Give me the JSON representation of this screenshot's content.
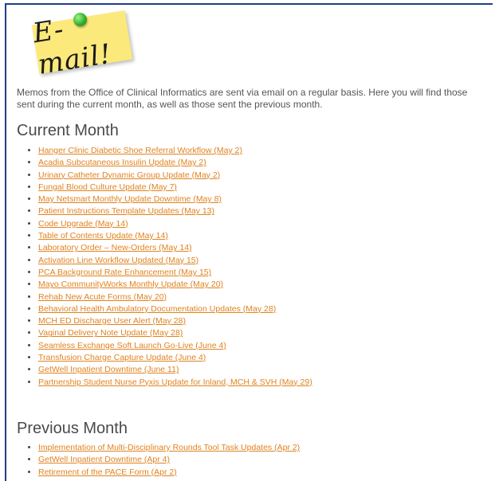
{
  "banner": {
    "text": "E-mail!"
  },
  "intro": "Memos from the Office of Clinical Informatics are sent via email on a regular basis.  Here you will find those sent during the current month, as well as those sent the previous month.",
  "current": {
    "heading": "Current Month",
    "items": [
      "Hanger Clinic Diabetic Shoe Referral Workflow (May 2)",
      "Acadia Subcutaneous Insulin Update (May 2)",
      "Urinary Catheter Dynamic Group Update (May 2)",
      "Fungal Blood Culture Update (May 7)",
      "May Netsmart Monthly Update Downtime (May 8)",
      "Patient Instructions Template Updates (May 13)",
      "Code Upgrade (May 14)",
      "Table of Contents Update (May 14)",
      "Laboratory Order – New-Orders (May 14)",
      "Activation Line Workflow Updated (May 15)",
      "PCA Background Rate Enhancement (May 15)",
      "Mayo CommunityWorks Monthly Update (May 20)",
      "Rehab New Acute Forms (May 20)",
      "Behavioral Health Ambulatory Documentation Updates (May 28)",
      "MCH ED Discharge User Alert (May 28)",
      "Vaginal Delivery Note Update (May 28)",
      "Seamless Exchange Soft Launch Go-Live (June 4)",
      "Transfusion Charge Capture Update (June 4)",
      "GetWell Inpatient Downtime (June 11)",
      "Partnership Student Nurse Pyxis Update for Inland, MCH & SVH (May 29)"
    ]
  },
  "previous": {
    "heading": "Previous Month",
    "items": [
      "Implementation of Multi-Disciplinary Rounds Tool Task Updates (Apr 2)",
      "GetWell Inpatient Downtime (Apr 4)",
      "Retirement of the PACE Form (Apr 2)"
    ]
  },
  "colors": {
    "link": "#e0821e",
    "border": "#1f3d8a",
    "note": "#fbe97b",
    "pin": "#2faa2a"
  }
}
